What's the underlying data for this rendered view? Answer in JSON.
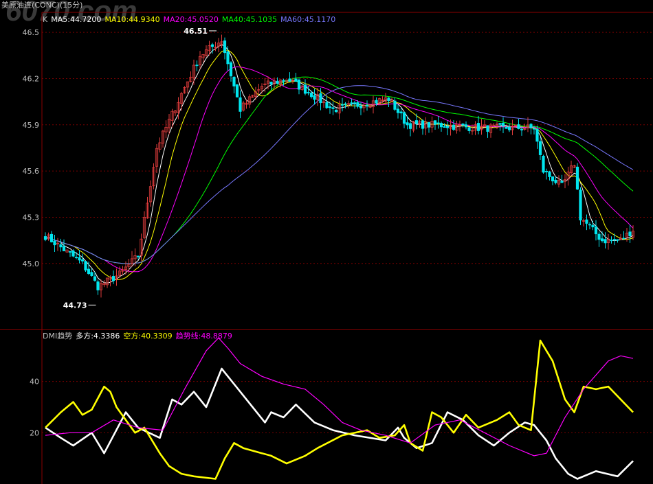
{
  "title": "美原油连(CONC)(15分)",
  "watermark": "6070.com",
  "colors": {
    "bg": "#000000",
    "frame": "#8b0000",
    "grid": "#7a0000",
    "up": "#e03c3c",
    "down": "#00e5ee",
    "axis_text": "#c0c0c0",
    "ma5": "#ffffff",
    "ma10": "#ffff00",
    "ma20": "#ff00ff",
    "ma40": "#00ff00",
    "ma60": "#7878ff"
  },
  "ma_header": [
    {
      "text": "K",
      "color": "#c0c0c0"
    },
    {
      "text": "MA5:44.7200",
      "color": "#ffffff"
    },
    {
      "text": "MA10:44.9340",
      "color": "#ffff00"
    },
    {
      "text": "MA20:45.0520",
      "color": "#ff00ff"
    },
    {
      "text": "MA40:45.1035",
      "color": "#00ff00"
    },
    {
      "text": "MA60:45.1170",
      "color": "#7878ff"
    }
  ],
  "dmi_header": [
    {
      "text": "DMI趋势",
      "color": "#c0c0c0"
    },
    {
      "text": "多方:4.3386",
      "color": "#ffffff"
    },
    {
      "text": "空方:40.3309",
      "color": "#ffff00"
    },
    {
      "text": "趋势线:48.8879",
      "color": "#ff00ff"
    }
  ],
  "chart_data": [
    {
      "type": "candlestick",
      "y_ticks": [
        "46.5",
        "46.2",
        "45.9",
        "45.6",
        "45.3",
        "45.0"
      ],
      "ylim": [
        44.58,
        46.63
      ],
      "annotations": [
        {
          "text": "46.51",
          "value": 46.51,
          "bar": 56,
          "side": "left"
        },
        {
          "text": "44.73",
          "value": 44.73,
          "bar": 17,
          "side": "left"
        }
      ],
      "key_points": [
        {
          "bar": 0,
          "price": 45.18
        },
        {
          "bar": 12,
          "price": 45.0
        },
        {
          "bar": 17,
          "price": 44.85
        },
        {
          "bar": 24,
          "price": 44.93
        },
        {
          "bar": 30,
          "price": 45.05
        },
        {
          "bar": 36,
          "price": 45.75
        },
        {
          "bar": 44,
          "price": 46.1
        },
        {
          "bar": 50,
          "price": 46.35
        },
        {
          "bar": 57,
          "price": 46.45
        },
        {
          "bar": 63,
          "price": 46.0
        },
        {
          "bar": 70,
          "price": 46.15
        },
        {
          "bar": 78,
          "price": 46.2
        },
        {
          "bar": 86,
          "price": 46.1
        },
        {
          "bar": 93,
          "price": 46.0
        },
        {
          "bar": 101,
          "price": 46.03
        },
        {
          "bar": 111,
          "price": 46.07
        },
        {
          "bar": 117,
          "price": 45.9
        },
        {
          "bar": 127,
          "price": 45.9
        },
        {
          "bar": 140,
          "price": 45.88
        },
        {
          "bar": 158,
          "price": 45.88
        },
        {
          "bar": 161,
          "price": 45.6
        },
        {
          "bar": 167,
          "price": 45.5
        },
        {
          "bar": 171,
          "price": 45.65
        },
        {
          "bar": 173,
          "price": 45.3
        },
        {
          "bar": 180,
          "price": 45.15
        },
        {
          "bar": 186,
          "price": 45.15
        },
        {
          "bar": 190,
          "price": 45.22
        }
      ]
    },
    {
      "type": "line",
      "title": "DMI趋势",
      "y_ticks": [
        "40",
        "20"
      ],
      "ylim": [
        0,
        60
      ],
      "series": [
        {
          "name": "多方",
          "color": "#ffffff",
          "width": 2.6,
          "x": [
            0,
            5,
            9,
            15,
            19,
            26,
            30,
            37,
            41,
            44,
            48,
            52,
            57,
            59,
            63,
            67,
            71,
            73,
            77,
            81,
            87,
            93,
            100,
            110,
            114,
            116,
            120,
            125,
            130,
            135,
            140,
            145,
            150,
            155,
            158,
            162,
            165,
            169,
            172,
            178,
            185,
            190
          ],
          "y": [
            22,
            18,
            15,
            20,
            12,
            28,
            22,
            18,
            33,
            31,
            36,
            30,
            45,
            42,
            36,
            30,
            24,
            28,
            26,
            31,
            24,
            21,
            19,
            17,
            22,
            18,
            14,
            16,
            28,
            25,
            19,
            15,
            20,
            24,
            23,
            17,
            10,
            4,
            2,
            5,
            3,
            9
          ]
        },
        {
          "name": "空方",
          "color": "#ffff00",
          "width": 2.6,
          "x": [
            0,
            5,
            9,
            12,
            15,
            19,
            21,
            23,
            26,
            29,
            32,
            37,
            40,
            44,
            48,
            55,
            58,
            61,
            64,
            67,
            70,
            73,
            78,
            84,
            88,
            96,
            104,
            108,
            113,
            116,
            118,
            122,
            125,
            128,
            132,
            136,
            140,
            146,
            150,
            153,
            157,
            160,
            162,
            164,
            168,
            171,
            174,
            178,
            182,
            186,
            190
          ],
          "y": [
            22,
            28,
            32,
            27,
            29,
            38,
            36,
            30,
            25,
            20,
            22,
            12,
            7,
            4,
            3,
            2,
            10,
            16,
            14,
            13,
            12,
            11,
            8,
            11,
            14,
            19,
            21,
            18,
            19,
            23,
            16,
            13,
            28,
            26,
            20,
            27,
            22,
            25,
            28,
            23,
            21,
            56,
            52,
            48,
            33,
            28,
            38,
            37,
            38,
            33,
            28
          ]
        },
        {
          "name": "趋势线",
          "color": "#ff00ff",
          "width": 1.2,
          "x": [
            0,
            8,
            15,
            22,
            30,
            38,
            45,
            52,
            56,
            59,
            63,
            70,
            77,
            84,
            90,
            96,
            102,
            110,
            118,
            126,
            134,
            142,
            150,
            158,
            162,
            168,
            174,
            182,
            186,
            190
          ],
          "y": [
            19,
            20,
            20,
            25,
            22,
            21,
            37,
            52,
            57,
            53,
            47,
            42,
            39,
            37,
            31,
            24,
            21,
            19,
            16,
            23,
            25,
            20,
            15,
            11,
            12,
            26,
            37,
            48,
            50,
            49
          ]
        }
      ]
    }
  ]
}
